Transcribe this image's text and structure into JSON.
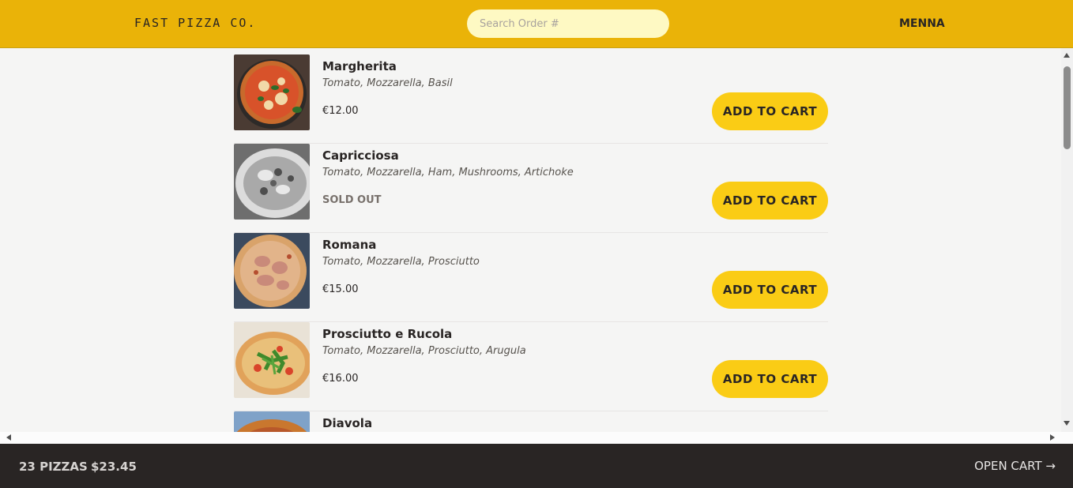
{
  "header": {
    "logo": "Fast Pizza Co.",
    "search_placeholder": "Search Order #",
    "username": "MENNA"
  },
  "menu": {
    "items": [
      {
        "name": "Margherita",
        "ingredients": "Tomato, Mozzarella, Basil",
        "price": "€12.00",
        "sold_out": false,
        "button": "ADD TO CART"
      },
      {
        "name": "Capricciosa",
        "ingredients": "Tomato, Mozzarella, Ham, Mushrooms, Artichoke",
        "price": "SOLD OUT",
        "sold_out": true,
        "button": "ADD TO CART"
      },
      {
        "name": "Romana",
        "ingredients": "Tomato, Mozzarella, Prosciutto",
        "price": "€15.00",
        "sold_out": false,
        "button": "ADD TO CART"
      },
      {
        "name": "Prosciutto e Rucola",
        "ingredients": "Tomato, Mozzarella, Prosciutto, Arugula",
        "price": "€16.00",
        "sold_out": false,
        "button": "ADD TO CART"
      },
      {
        "name": "Diavola",
        "ingredients": "",
        "price": "",
        "sold_out": false,
        "button": ""
      }
    ]
  },
  "cart_overview": {
    "pizza_count": "23 pizzas",
    "total": "$23.45",
    "open_cart": "Open cart →"
  },
  "colors": {
    "header_bg": "#eab308",
    "button_bg": "#facc15",
    "footer_bg": "#292524",
    "page_bg": "#f5f5f4"
  }
}
